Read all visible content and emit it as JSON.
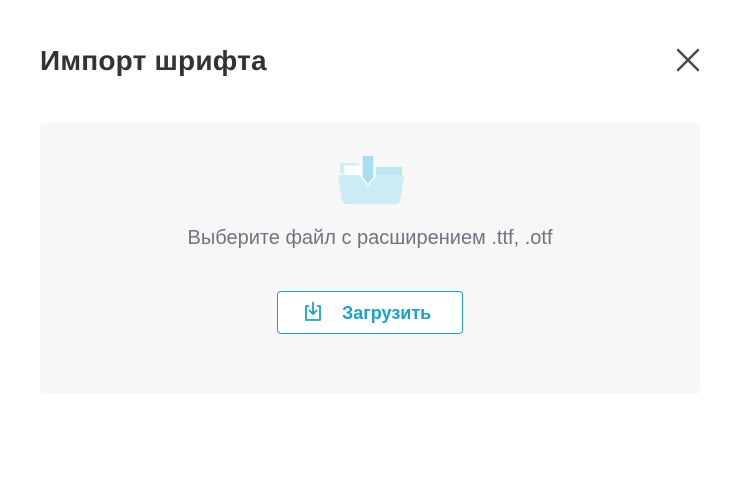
{
  "dialog": {
    "title": "Импорт шрифта",
    "close_icon": "close-icon"
  },
  "dropzone": {
    "illustration_icon": "folder-download-icon",
    "hint": "Выберите файл с расширением .ttf, .otf",
    "upload_button": {
      "label": "Загрузить",
      "icon": "download-tray-icon"
    }
  },
  "colors": {
    "accent": "#1aa3c8",
    "title_text": "#333333",
    "hint_text": "#6b7680",
    "dropzone_bg": "#f7f7f7"
  }
}
